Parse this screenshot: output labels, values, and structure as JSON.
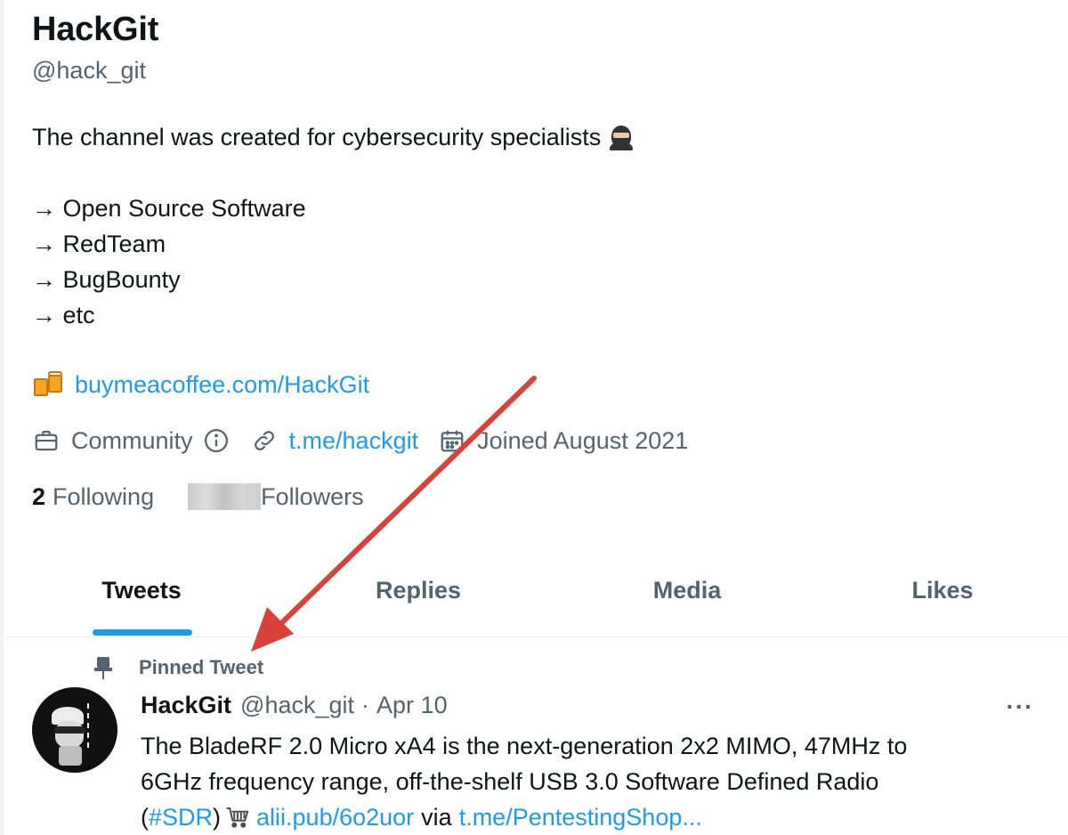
{
  "profile": {
    "name": "HackGit",
    "handle": "@hack_git",
    "bio": {
      "line1": "The channel was created for cybersecurity specialists",
      "items": [
        "→ Open Source Software",
        "→ RedTeam",
        "→ BugBounty",
        "→ etc"
      ]
    },
    "link_text": "buymeacoffee.com/HackGit",
    "meta": {
      "category": "Community",
      "url": "t.me/hackgit",
      "joined": "Joined August 2021"
    },
    "stats": {
      "following_count": "2",
      "following_label": "Following",
      "followers_label": "Followers"
    }
  },
  "tabs": [
    {
      "label": "Tweets",
      "active": true
    },
    {
      "label": "Replies",
      "active": false
    },
    {
      "label": "Media",
      "active": false
    },
    {
      "label": "Likes",
      "active": false
    }
  ],
  "pinned_tweet": {
    "pinned_label": "Pinned Tweet",
    "author": "HackGit",
    "handle": "@hack_git",
    "separator": "·",
    "date": "Apr 10",
    "more_label": "···",
    "text_line1": "The BladeRF 2.0 Micro xA4 is the next-generation 2x2 MIMO, 47MHz to",
    "text_line2": "6GHz frequency range, off-the-shelf USB 3.0 Software Defined Radio",
    "text_line3_open": "(",
    "hashtag": "#SDR",
    "text_line3_close": ")",
    "link1": "alii.pub/6o2uor",
    "via": "via",
    "link2": "t.me/PentestingShop..."
  },
  "colors": {
    "accent": "#1d9bf0",
    "text_primary": "#0f1419",
    "text_secondary": "#536471",
    "annotation_arrow": "#d9413a"
  },
  "icons": {
    "bio_emoji": "ninja-emoji-icon",
    "link": "beer-mugs-icon",
    "category": "briefcase-icon",
    "info": "info-icon",
    "url": "link-icon",
    "joined": "calendar-icon",
    "pin": "pin-icon",
    "cart": "shopping-cart-icon"
  }
}
